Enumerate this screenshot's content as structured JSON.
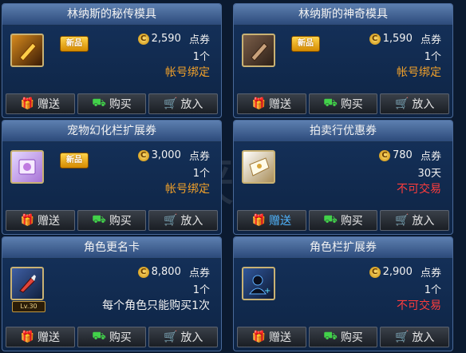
{
  "watermark": "游侠",
  "buttons": {
    "gift": "赠送",
    "buy": "购买",
    "cart": "放入"
  },
  "cards": [
    {
      "title": "林纳斯的秘传模具",
      "new_badge": "新品",
      "price": "2,590",
      "unit": "点券",
      "qty": "1个",
      "note": "帐号绑定",
      "note_color": "orange",
      "icon": "golden-mold-icon"
    },
    {
      "title": "林纳斯的神奇模具",
      "new_badge": "新品",
      "price": "1,590",
      "unit": "点券",
      "qty": "1个",
      "note": "帐号绑定",
      "note_color": "orange",
      "icon": "bronze-mold-icon"
    },
    {
      "title": "宠物幻化栏扩展券",
      "new_badge": "新品",
      "price": "3,000",
      "unit": "点券",
      "qty": "1个",
      "note": "帐号绑定",
      "note_color": "orange",
      "icon": "pet-ticket-icon"
    },
    {
      "title": "拍卖行优惠券",
      "price": "780",
      "unit": "点券",
      "qty": "30天",
      "note": "不可交易",
      "note_color": "red",
      "icon": "auction-coupon-icon"
    },
    {
      "title": "角色更名卡",
      "price": "8,800",
      "unit": "点券",
      "qty": "1个",
      "note": "每个角色只能购买1次",
      "note_color": "white",
      "icon": "rename-card-icon",
      "level": "Lv.30"
    },
    {
      "title": "角色栏扩展券",
      "price": "2,900",
      "unit": "点券",
      "qty": "1个",
      "note": "不可交易",
      "note_color": "red",
      "icon": "character-slot-icon"
    }
  ]
}
